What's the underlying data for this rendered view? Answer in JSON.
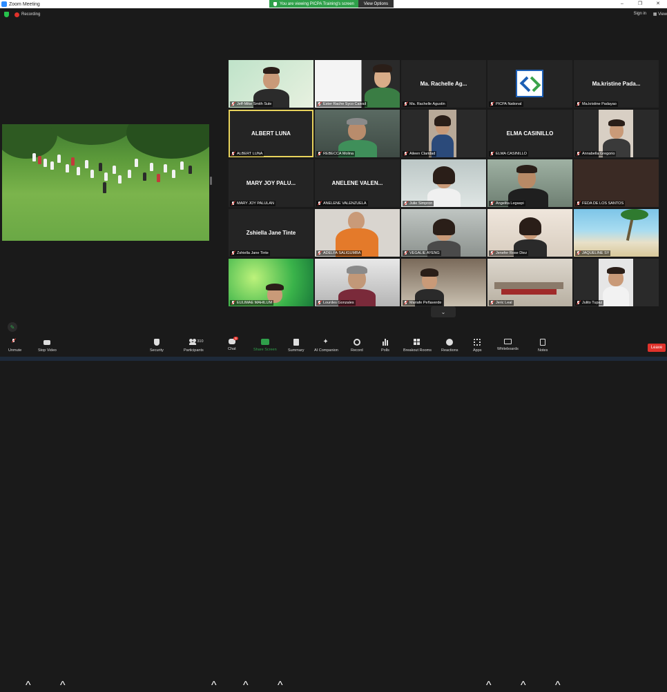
{
  "window": {
    "title": "Zoom Meeting"
  },
  "banner": {
    "message": "You are viewing PICPA Training's screen",
    "view_options": "View Options"
  },
  "status": {
    "recording": "Recording"
  },
  "header": {
    "sign_in": "Sign in",
    "view": "View"
  },
  "tiles": [
    {
      "name": "Jeff-Mike Smith Sule",
      "big": ""
    },
    {
      "name": "Ester Rache  Syco Caivail",
      "big": ""
    },
    {
      "name": "Ma. Rachelle Agustin",
      "big": "Ma. Rachelle Ag..."
    },
    {
      "name": "PICPA National",
      "big": ""
    },
    {
      "name": "Ma.kristine Padayao",
      "big": "Ma.kristine  Pada..."
    },
    {
      "name": "ALBERT LUNA",
      "big": "ALBERT LUNA"
    },
    {
      "name": "REBECCA Molina",
      "big": ""
    },
    {
      "name": "Aileen Claridad",
      "big": ""
    },
    {
      "name": "ELMA CASINILLO",
      "big": "ELMA CASINILLO"
    },
    {
      "name": "Annabella Gregorio",
      "big": ""
    },
    {
      "name": "MARY JOY PALULAN",
      "big": "MARY JOY PALU..."
    },
    {
      "name": "ANELENE VALENZUELA",
      "big": "ANELENE  VALEN..."
    },
    {
      "name": "Julie Simpron",
      "big": ""
    },
    {
      "name": "Angelita Legaspi",
      "big": ""
    },
    {
      "name": "FEDA DE LOS SANTOS",
      "big": ""
    },
    {
      "name": "Zshiella Jane Tinte",
      "big": "Zshiella Jane Tinte"
    },
    {
      "name": "ADELFA SALIGUMBA",
      "big": ""
    },
    {
      "name": "VEGALIE AYENG",
      "big": ""
    },
    {
      "name": "Jenefer Rose Diez",
      "big": ""
    },
    {
      "name": "JAQUELINE SY",
      "big": ""
    },
    {
      "name": "EULIMAE MAHILUM",
      "big": ""
    },
    {
      "name": "Lourdes Gonzales",
      "big": ""
    },
    {
      "name": "Mariafe Peñaverde",
      "big": ""
    },
    {
      "name": "Jeric Leal",
      "big": ""
    },
    {
      "name": "Julito Tupaz",
      "big": ""
    }
  ],
  "toolbar": {
    "unmute": "Unmute",
    "stop_video": "Stop Video",
    "security": "Security",
    "participants": "Participants",
    "participant_count": "310",
    "chat": "Chat",
    "chat_badge": "9",
    "share_screen": "Share Screen",
    "summary": "Summary",
    "ai_companion": "AI Companion",
    "record": "Record",
    "polls": "Polls",
    "breakout_rooms": "Breakout Rooms",
    "reactions": "Reactions",
    "apps": "Apps",
    "whiteboards": "Whiteboards",
    "notes": "Notes",
    "leave": "Leave"
  },
  "colors": {
    "accent_green": "#2fa04a",
    "leave_red": "#e0322b",
    "active_speaker": "#e8d35c"
  }
}
